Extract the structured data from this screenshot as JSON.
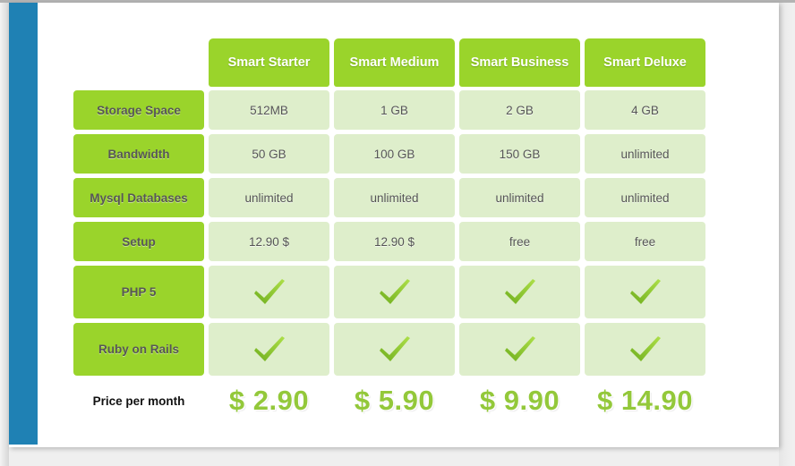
{
  "page": {
    "accent_color": "#1f81b4",
    "brand_green": "#9ad42b",
    "cell_green": "#deeecb",
    "price_green": "#93c83a",
    "background": "#efefef"
  },
  "table": {
    "plans": [
      {
        "name": "Smart Starter"
      },
      {
        "name": "Smart Medium"
      },
      {
        "name": "Smart Business"
      },
      {
        "name": "Smart Deluxe"
      }
    ],
    "rows": [
      {
        "label": "Storage Space",
        "type": "text",
        "values": [
          "512MB",
          "1 GB",
          "2 GB",
          "4 GB"
        ]
      },
      {
        "label": "Bandwidth",
        "type": "text",
        "values": [
          "50 GB",
          "100 GB",
          "150 GB",
          "unlimited"
        ]
      },
      {
        "label": "Mysql Databases",
        "type": "text",
        "values": [
          "unlimited",
          "unlimited",
          "unlimited",
          "unlimited"
        ]
      },
      {
        "label": "Setup",
        "type": "text",
        "values": [
          "12.90 $",
          "12.90 $",
          "free",
          "free"
        ]
      },
      {
        "label": "PHP 5",
        "type": "check",
        "values": [
          "check-icon",
          "check-icon",
          "check-icon",
          "check-icon"
        ]
      },
      {
        "label": "Ruby on Rails",
        "type": "check",
        "values": [
          "check-icon",
          "check-icon",
          "check-icon",
          "check-icon"
        ]
      }
    ],
    "price_row": {
      "label": "Price per month",
      "values": [
        "$ 2.90",
        "$ 5.90",
        "$ 9.90",
        "$ 14.90"
      ]
    }
  }
}
